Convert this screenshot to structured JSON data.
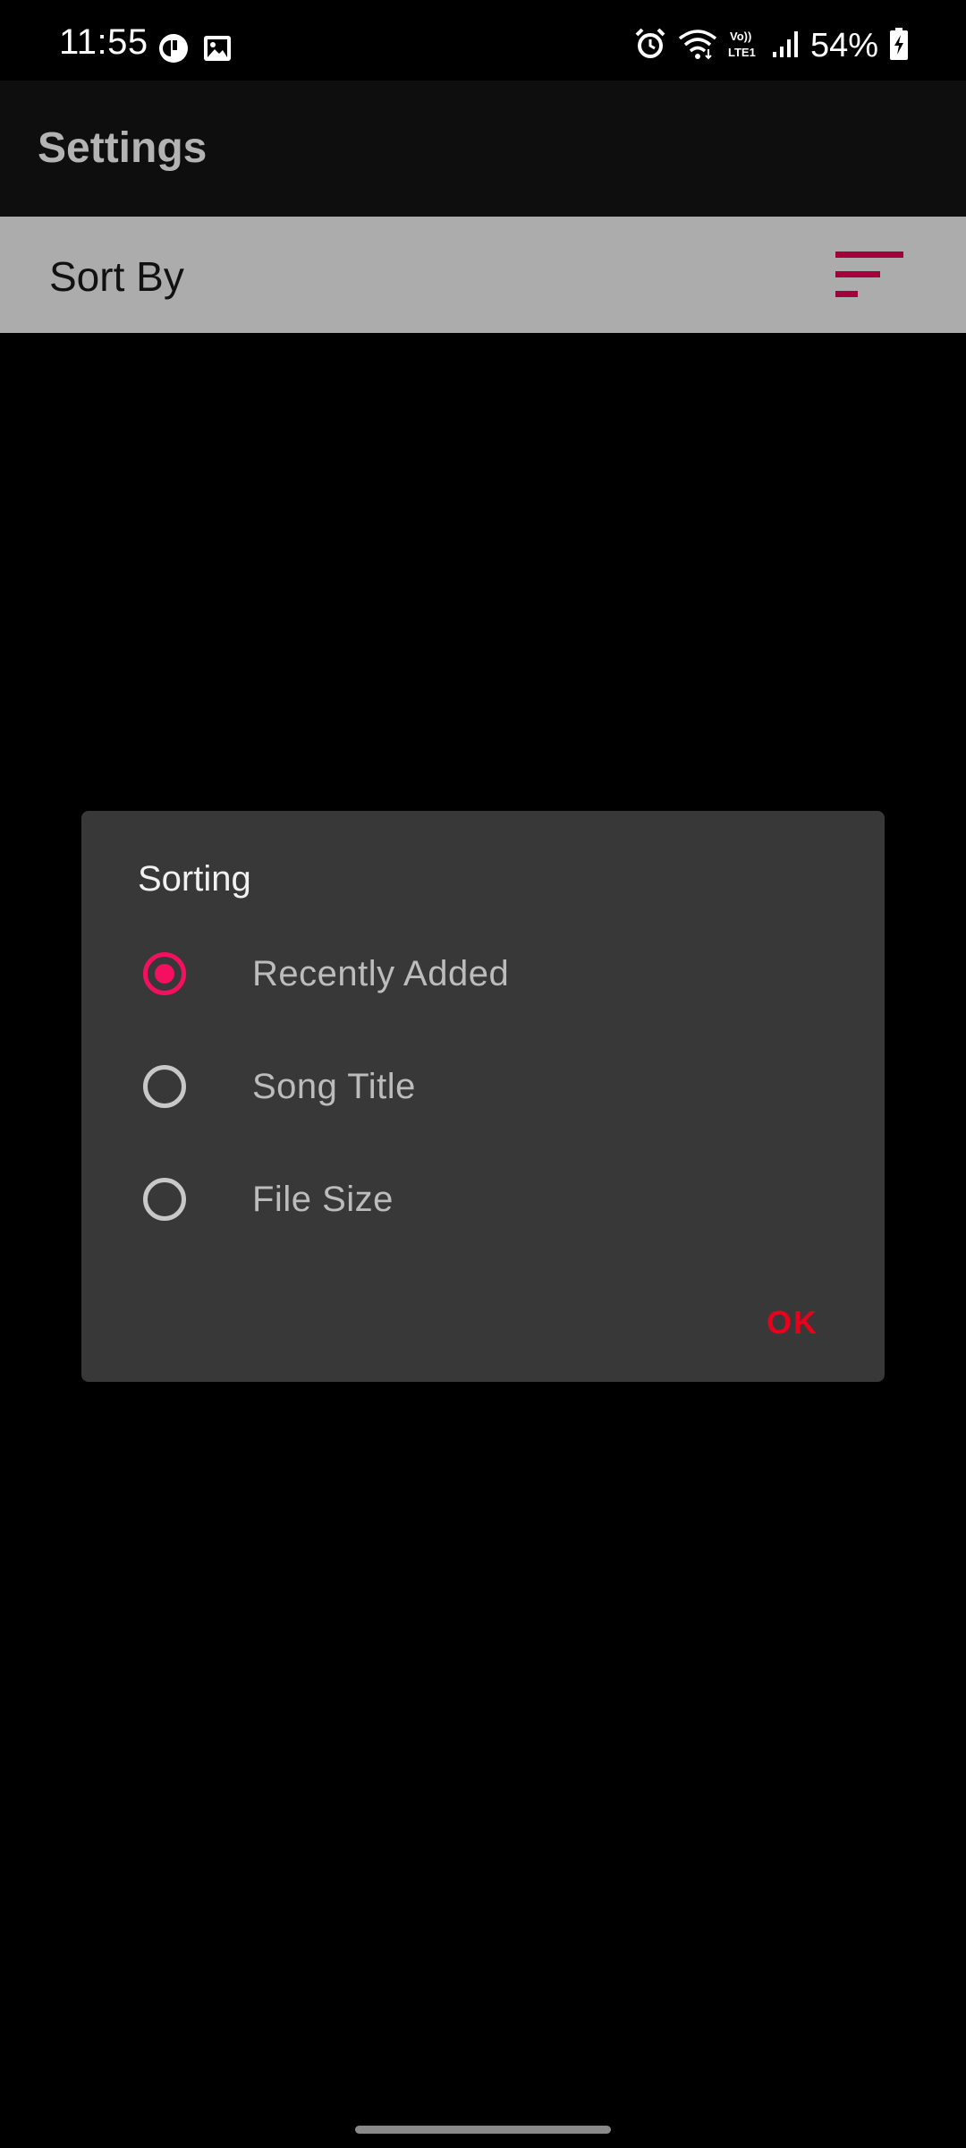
{
  "status_bar": {
    "time": "11:55",
    "battery": "54%",
    "icons": [
      "notification-badge-icon",
      "gallery-icon",
      "alarm-icon",
      "wifi-icon",
      "volte-icon",
      "signal-icon",
      "battery-charging-icon"
    ],
    "volte_text": "Vo))\nLTE1"
  },
  "app_bar": {
    "title": "Settings"
  },
  "sort_row": {
    "label": "Sort By",
    "icon": "sort-icon",
    "accent_color": "#a3003c"
  },
  "dialog": {
    "title": "Sorting",
    "options": [
      {
        "label": "Recently Added",
        "selected": true
      },
      {
        "label": "Song Title",
        "selected": false
      },
      {
        "label": "File Size",
        "selected": false
      }
    ],
    "ok_label": "OK",
    "ok_color": "#e8001c",
    "radio_color": "#f5105f"
  }
}
